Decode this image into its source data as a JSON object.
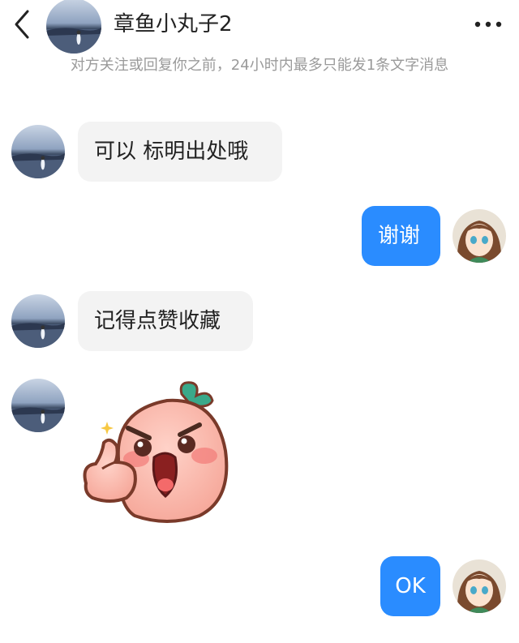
{
  "header": {
    "contact_name": "章鱼小丸子2",
    "notice": "对方关注或回复你之前，24小时内最多只能发1条文字消息"
  },
  "messages": [
    {
      "from": "contact",
      "text": "可以 标明出处哦"
    },
    {
      "from": "me",
      "text": "谢谢"
    },
    {
      "from": "contact",
      "text": "记得点赞收藏"
    },
    {
      "from": "contact",
      "type": "sticker",
      "sticker": "peach-thumbs-up-sticker"
    },
    {
      "from": "me",
      "text": "OK"
    }
  ],
  "colors": {
    "outgoing_bubble": "#2a8cff",
    "incoming_bubble": "#f3f3f3",
    "notice_text": "#9a9a9a"
  },
  "icons": {
    "back": "chevron-left-icon",
    "more": "more-dots-icon"
  }
}
